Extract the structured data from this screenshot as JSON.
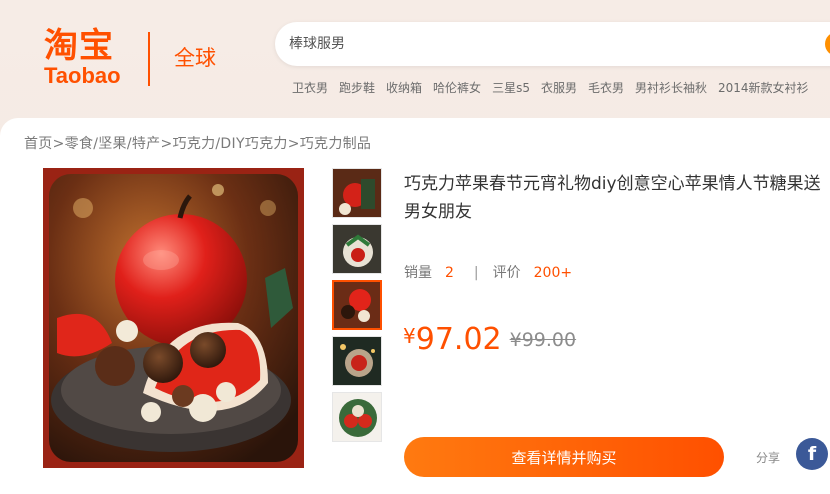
{
  "header": {
    "logo_cn": "淘宝",
    "logo_en": "Taobao",
    "region": "全球"
  },
  "search": {
    "placeholder": "棒球服男"
  },
  "hot_searches": [
    "卫衣男",
    "跑步鞋",
    "收纳箱",
    "哈伦裤女",
    "三星s5",
    "衣服男",
    "毛衣男",
    "男衬衫长袖秋",
    "2014新款女衬衫"
  ],
  "breadcrumb": [
    "首页",
    "零食/坚果/特产",
    "巧克力/DIY巧克力",
    "巧克力制品"
  ],
  "breadcrumb_separator": ">",
  "product": {
    "title": "巧克力苹果春节元宵礼物diy创意空心苹果情人节糖果送男女朋友",
    "sales_label": "销量",
    "sales_value": "2",
    "review_label": "评价",
    "review_value": "200+",
    "stats_separator": "|",
    "currency": "¥",
    "price": "97.02",
    "original_price": "¥99.00",
    "buy_label": "查看详情并购买",
    "share_label": "分享",
    "facebook_glyph": "f"
  },
  "colors": {
    "accent": "#ff5000",
    "facebook": "#3b5998"
  }
}
